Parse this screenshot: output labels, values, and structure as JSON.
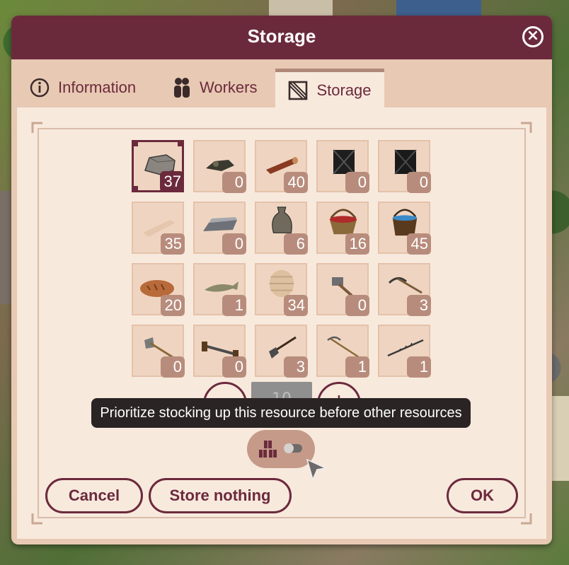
{
  "dialog": {
    "title": "Storage"
  },
  "tabs": [
    {
      "label": "Information",
      "icon": "info-icon"
    },
    {
      "label": "Workers",
      "icon": "workers-icon"
    },
    {
      "label": "Storage",
      "icon": "crate-icon",
      "active": true
    }
  ],
  "slots": [
    {
      "item": "stone",
      "count": "37",
      "selected": true
    },
    {
      "item": "coal",
      "count": "0"
    },
    {
      "item": "log",
      "count": "40"
    },
    {
      "item": "ore-crate",
      "count": "0"
    },
    {
      "item": "ore-crate-dark",
      "count": "0"
    },
    {
      "item": "plank",
      "count": "35",
      "faded": true
    },
    {
      "item": "iron-ingot",
      "count": "0"
    },
    {
      "item": "flour-sack",
      "count": "6"
    },
    {
      "item": "berry-basket",
      "count": "16"
    },
    {
      "item": "water-bucket",
      "count": "45"
    },
    {
      "item": "bread",
      "count": "20"
    },
    {
      "item": "fish",
      "count": "1"
    },
    {
      "item": "barrel",
      "count": "34",
      "faded": true
    },
    {
      "item": "hammer",
      "count": "0"
    },
    {
      "item": "pickaxe",
      "count": "3"
    },
    {
      "item": "axe",
      "count": "0"
    },
    {
      "item": "saw",
      "count": "0"
    },
    {
      "item": "shovel",
      "count": "3"
    },
    {
      "item": "scythe",
      "count": "1"
    },
    {
      "item": "fishing-rod",
      "count": "1"
    }
  ],
  "stepper": {
    "minus": "−",
    "value": "10",
    "plus": "+"
  },
  "tooltip": "Prioritize stocking up this resource before other resources",
  "priority_toggle": {
    "icon": "crates-icon",
    "on": false
  },
  "buttons": {
    "cancel": "Cancel",
    "store_nothing": "Store nothing",
    "ok": "OK"
  },
  "colors": {
    "accent": "#6b2a3c",
    "panel": "#f8e9dd",
    "frame": "#e8c9b3",
    "badge": "#b88c7c"
  }
}
